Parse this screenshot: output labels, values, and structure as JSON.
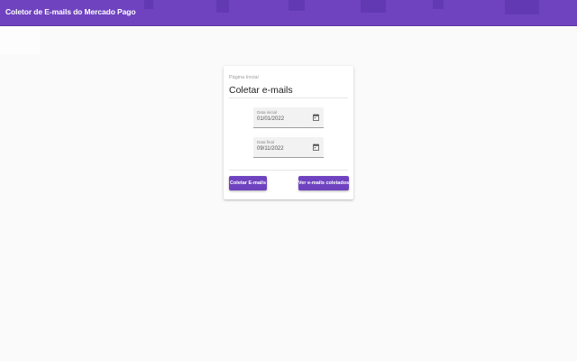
{
  "app": {
    "title": "Coletor de E-mails do Mercado Pago",
    "accent": "#6f43c0"
  },
  "card": {
    "breadcrumb": "Página Inicial",
    "title": "Coletar e-mails",
    "fields": [
      {
        "label": "Data inicial",
        "value": "01/01/2022",
        "icon": "calendar-icon"
      },
      {
        "label": "Data final",
        "value": "09/11/2022",
        "icon": "calendar-icon"
      }
    ],
    "buttons": {
      "collect": "Coletar E-mails",
      "view": "Ver e-mails coletados"
    }
  }
}
